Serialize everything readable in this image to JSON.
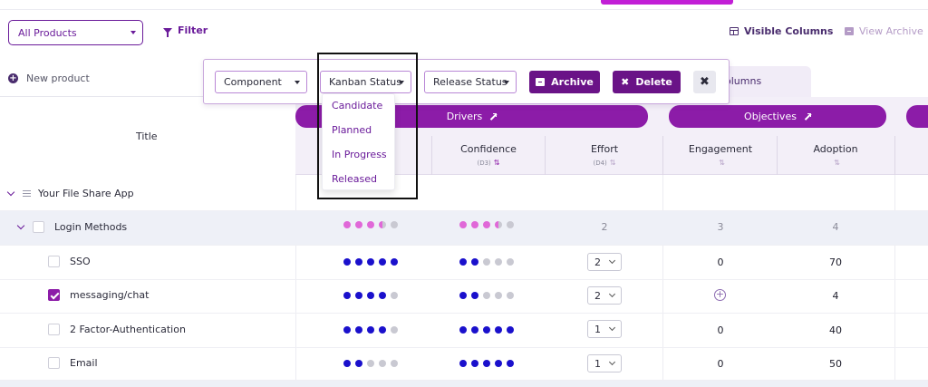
{
  "header": {
    "product_select": "All Products",
    "filter_label": "Filter",
    "visible_columns_label": "Visible Columns",
    "view_archive_label": "View Archive"
  },
  "sidebar": {
    "new_product_label": "New product",
    "title_header": "Title"
  },
  "background_tab": "olumns",
  "toolbar": {
    "component_select": "Component",
    "kanban_select": "Kanban Status",
    "release_select": "Release Status",
    "archive_label": "Archive",
    "delete_label": "Delete"
  },
  "kanban_dropdown": {
    "options": [
      "Candidate",
      "Planned",
      "In Progress",
      "Released"
    ]
  },
  "groups": {
    "drivers": "Drivers",
    "objectives": "Objectives"
  },
  "columns": [
    {
      "label": "Confidence",
      "code": "(D3)"
    },
    {
      "label": "Effort",
      "code": "(D4)"
    },
    {
      "label": "Engagement",
      "code": ""
    },
    {
      "label": "Adoption",
      "code": ""
    }
  ],
  "colors": {
    "accent": "#8c1ca8",
    "accent_dark": "#6a1387",
    "dot_blue": "#1a10cc",
    "dot_pink": "#e068d8",
    "dot_empty": "#c9c9d2"
  },
  "rows": [
    {
      "title": "Your File Share App",
      "level": 0
    },
    {
      "title": "Login Methods",
      "level": 1,
      "drivers_a": 3.5,
      "drivers_b": 3.5,
      "effort": "2",
      "engagement": "3",
      "adoption": "4"
    },
    {
      "title": "SSO",
      "level": 2,
      "checked": false,
      "drivers_a": 5,
      "drivers_b": 2,
      "effort": "2",
      "engagement": "0",
      "adoption": "70"
    },
    {
      "title": "messaging/chat",
      "level": 2,
      "checked": true,
      "drivers_a": 4,
      "drivers_b": 2,
      "effort": "2",
      "engagement": "",
      "adoption": "4"
    },
    {
      "title": "2 Factor-Authentication",
      "level": 2,
      "checked": false,
      "drivers_a": 4,
      "drivers_b": 5,
      "effort": "1",
      "engagement": "0",
      "adoption": "40"
    },
    {
      "title": "Email",
      "level": 2,
      "checked": false,
      "drivers_a": 2,
      "drivers_b": 5,
      "effort": "1",
      "engagement": "0",
      "adoption": "50"
    }
  ]
}
